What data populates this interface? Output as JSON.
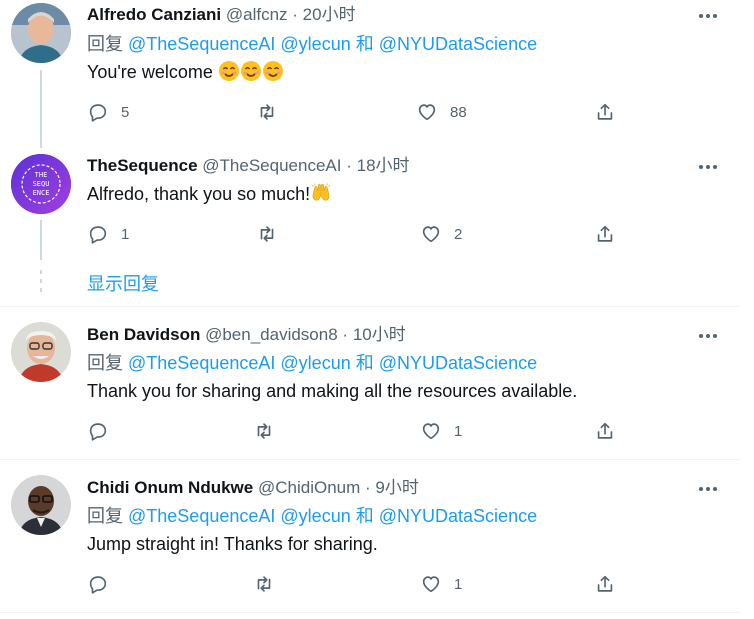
{
  "tweets": [
    {
      "name": "Alfredo Canziani",
      "handle": "@alfcnz",
      "dot": "·",
      "time": "20小时",
      "reply_prefix": "回复",
      "mentions": [
        "@TheSequenceAI",
        "@ylecun",
        "@NYUDataScience"
      ],
      "and": "和",
      "text": "You're welcome",
      "emoji": [
        "smiling-face-icon",
        "smiling-face-icon",
        "smiling-face-icon"
      ],
      "replies": "5",
      "retweets": "",
      "likes": "88"
    },
    {
      "name": "TheSequence",
      "handle": "@TheSequenceAI",
      "dot": "·",
      "time": "18小时",
      "avatar_text": [
        "THE",
        "SEQU",
        "ENCE"
      ],
      "text": "Alfredo, thank you so much!",
      "emoji": [
        "raising-hands-icon"
      ],
      "replies": "1",
      "retweets": "",
      "likes": "2"
    },
    {
      "name": "Ben Davidson",
      "handle": "@ben_davidson8",
      "dot": "·",
      "time": "10小时",
      "reply_prefix": "回复",
      "mentions": [
        "@TheSequenceAI",
        "@ylecun",
        "@NYUDataScience"
      ],
      "and": "和",
      "text": "Thank you for sharing and making all the resources available.",
      "replies": "",
      "retweets": "",
      "likes": "1"
    },
    {
      "name": "Chidi Onum Ndukwe",
      "handle": "@ChidiOnum",
      "dot": "·",
      "time": "9小时",
      "reply_prefix": "回复",
      "mentions": [
        "@TheSequenceAI",
        "@ylecun",
        "@NYUDataScience"
      ],
      "and": "和",
      "text": "Jump straight in! Thanks for sharing.",
      "replies": "",
      "retweets": "",
      "likes": "1"
    }
  ],
  "show_replies": "显示回复",
  "colors": {
    "accent": "#1d9bf0",
    "secondary_text": "#536471",
    "primary_text": "#0f1419",
    "sequence_purple": "#7b3fe4"
  }
}
